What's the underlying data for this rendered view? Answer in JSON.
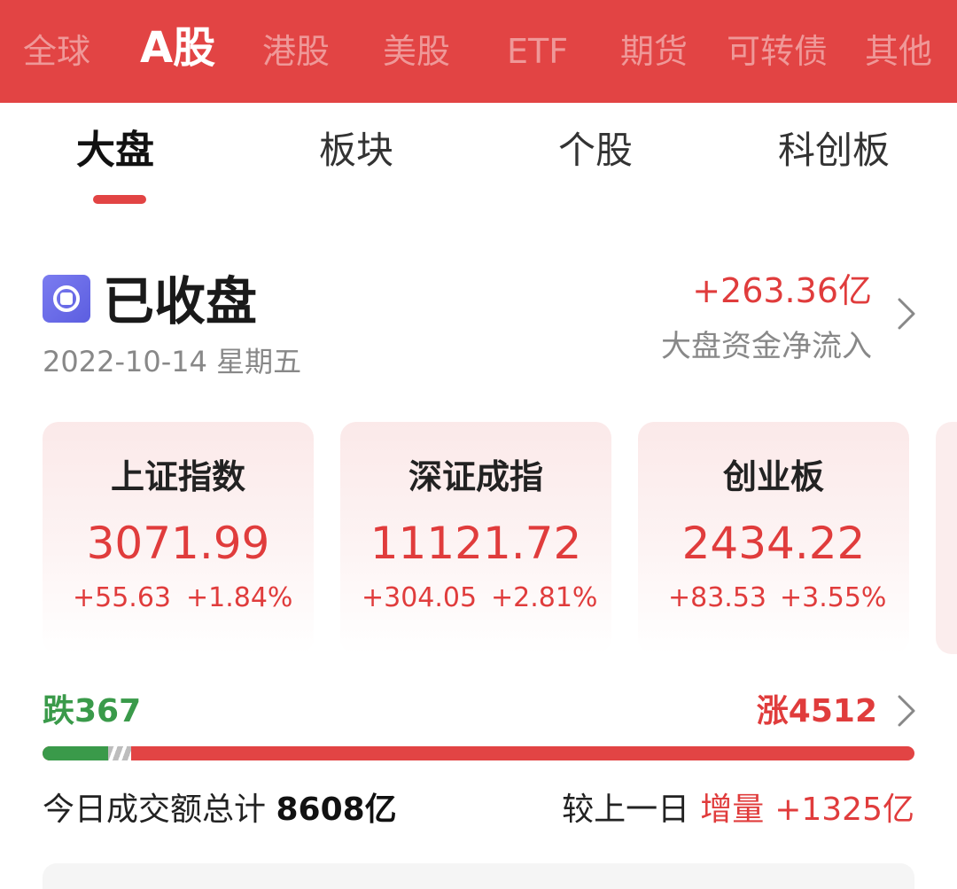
{
  "market_tabs": [
    {
      "label": "全球",
      "active": false
    },
    {
      "label": "A股",
      "active": true
    },
    {
      "label": "港股",
      "active": false
    },
    {
      "label": "美股",
      "active": false
    },
    {
      "label": "ETF",
      "active": false
    },
    {
      "label": "期货",
      "active": false
    },
    {
      "label": "可转债",
      "active": false
    },
    {
      "label": "其他",
      "active": false
    }
  ],
  "sub_tabs": [
    {
      "label": "大盘",
      "active": true
    },
    {
      "label": "板块",
      "active": false
    },
    {
      "label": "个股",
      "active": false
    },
    {
      "label": "科创板",
      "active": false
    }
  ],
  "status": {
    "title": "已收盘",
    "date": "2022-10-14 星期五",
    "icon": "market-closed-icon"
  },
  "fund_flow": {
    "value": "+263.36亿",
    "label": "大盘资金净流入"
  },
  "indices": [
    {
      "name": "上证指数",
      "value": "3071.99",
      "change": "+55.63",
      "change_pct": "+1.84%"
    },
    {
      "name": "深证成指",
      "value": "11121.72",
      "change": "+304.05",
      "change_pct": "+2.81%"
    },
    {
      "name": "创业板",
      "value": "2434.22",
      "change": "+83.53",
      "change_pct": "+3.55%"
    }
  ],
  "breadth": {
    "fall_label": "跌367",
    "rise_label": "涨4512",
    "fall": 367,
    "rise": 4512
  },
  "turnover": {
    "label": "今日成交额总计",
    "value": "8608亿",
    "compare_label": "较上一日",
    "compare_tag": "增量",
    "compare_value": "+1325亿"
  },
  "colors": {
    "brand_red": "#e24444",
    "up_red": "#e03c3c",
    "down_green": "#3a9a4a"
  }
}
